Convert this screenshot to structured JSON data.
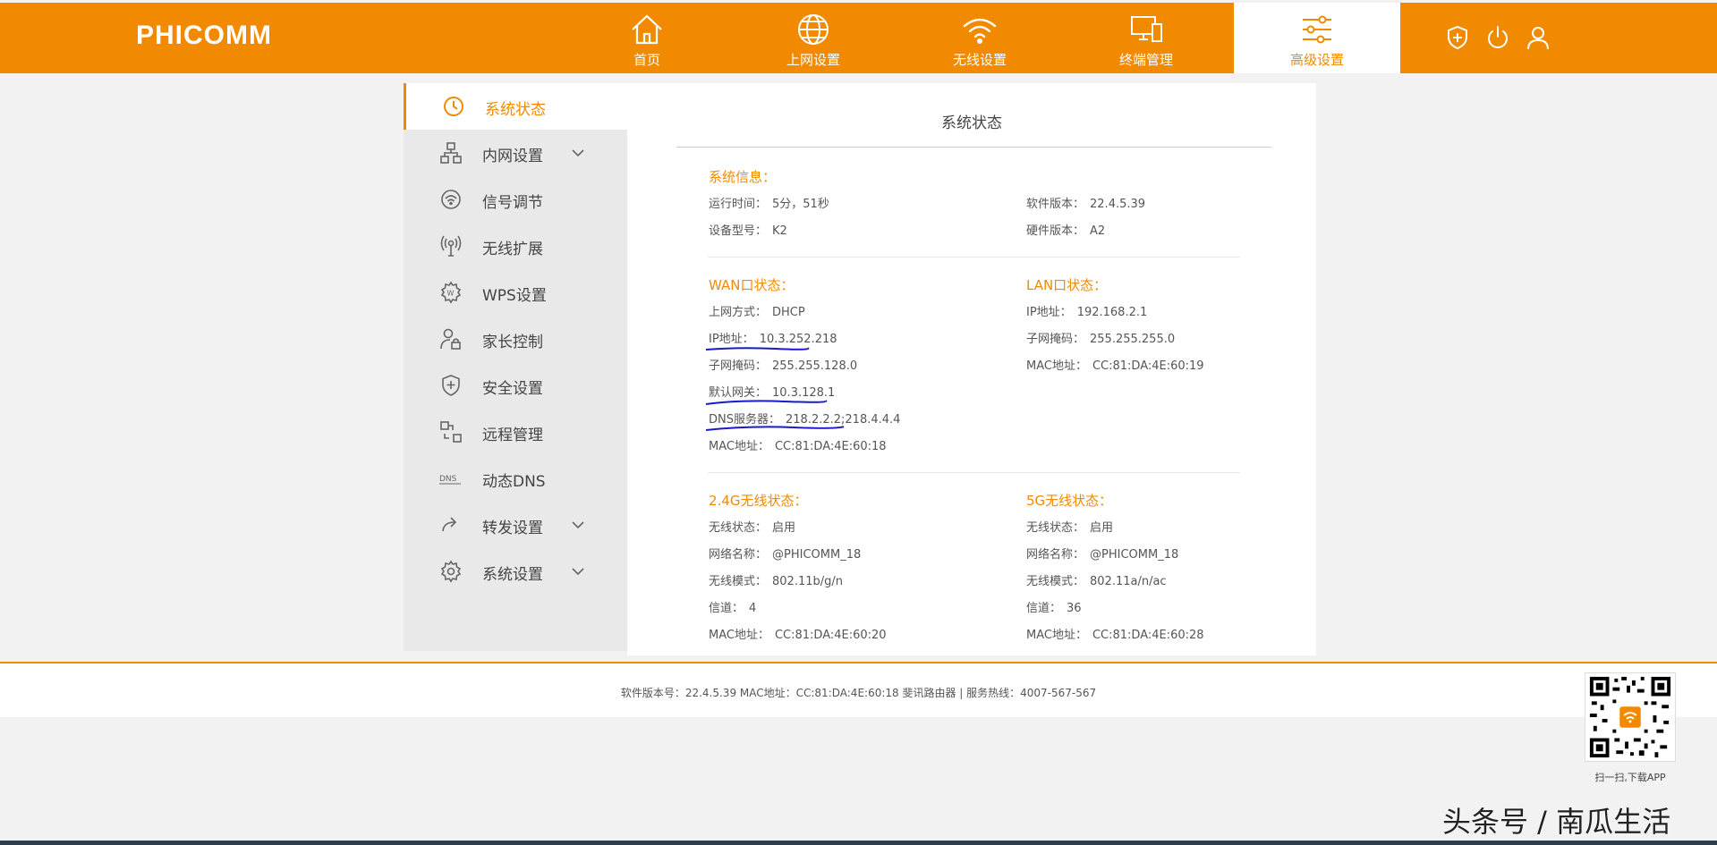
{
  "header": {
    "logo": "PHICOMM",
    "nav": [
      {
        "label": "首页",
        "icon": "home-icon"
      },
      {
        "label": "上网设置",
        "icon": "globe-icon"
      },
      {
        "label": "无线设置",
        "icon": "wifi-icon"
      },
      {
        "label": "终端管理",
        "icon": "devices-icon"
      },
      {
        "label": "高级设置",
        "icon": "sliders-icon"
      }
    ],
    "right_icons": [
      "shield-plus-icon",
      "power-icon",
      "user-icon"
    ]
  },
  "sidebar": {
    "items": [
      {
        "label": "系统状态",
        "icon": "clock-icon"
      },
      {
        "label": "内网设置",
        "icon": "network-icon"
      },
      {
        "label": "信号调节",
        "icon": "signal-icon"
      },
      {
        "label": "无线扩展",
        "icon": "antenna-icon"
      },
      {
        "label": "WPS设置",
        "icon": "wps-gear-icon"
      },
      {
        "label": "家长控制",
        "icon": "parent-lock-icon"
      },
      {
        "label": "安全设置",
        "icon": "shield-plus-icon"
      },
      {
        "label": "远程管理",
        "icon": "remote-icon"
      },
      {
        "label": "动态DNS",
        "icon": "dns-icon"
      },
      {
        "label": "转发设置",
        "icon": "forward-icon"
      },
      {
        "label": "系统设置",
        "icon": "gear-icon"
      }
    ]
  },
  "main": {
    "title": "系统状态",
    "system_info": {
      "title": "系统信息：",
      "uptime_label": "运行时间：",
      "uptime_value": "5分，51秒",
      "model_label": "设备型号：",
      "model_value": "K2",
      "sw_label": "软件版本：",
      "sw_value": "22.4.5.39",
      "hw_label": "硬件版本：",
      "hw_value": "A2"
    },
    "wan": {
      "title": "WAN口状态：",
      "mode_label": "上网方式：",
      "mode_value": "DHCP",
      "ip_label": "IP地址：",
      "ip_value": "10.3.252.218",
      "mask_label": "子网掩码：",
      "mask_value": "255.255.128.0",
      "gw_label": "默认网关：",
      "gw_value": "10.3.128.1",
      "dns_label": "DNS服务器：",
      "dns_value": "218.2.2.2;218.4.4.4",
      "mac_label": "MAC地址：",
      "mac_value": "CC:81:DA:4E:60:18"
    },
    "lan": {
      "title": "LAN口状态：",
      "ip_label": "IP地址：",
      "ip_value": "192.168.2.1",
      "mask_label": "子网掩码：",
      "mask_value": "255.255.255.0",
      "mac_label": "MAC地址：",
      "mac_value": "CC:81:DA:4E:60:19"
    },
    "w24": {
      "title": "2.4G无线状态：",
      "state_label": "无线状态：",
      "state_value": "启用",
      "ssid_label": "网络名称：",
      "ssid_value": "@PHICOMM_18",
      "mode_label": "无线模式：",
      "mode_value": "802.11b/g/n",
      "ch_label": "信道：",
      "ch_value": "4",
      "mac_label": "MAC地址：",
      "mac_value": "CC:81:DA:4E:60:20"
    },
    "w5": {
      "title": "5G无线状态：",
      "state_label": "无线状态：",
      "state_value": "启用",
      "ssid_label": "网络名称：",
      "ssid_value": "@PHICOMM_18",
      "mode_label": "无线模式：",
      "mode_value": "802.11a/n/ac",
      "ch_label": "信道：",
      "ch_value": "36",
      "mac_label": "MAC地址：",
      "mac_value": "CC:81:DA:4E:60:28"
    }
  },
  "footer": {
    "text": "软件版本号：22.4.5.39    MAC地址：CC:81:DA:4E:60:18    斐讯路由器 | 服务热线：4007-567-567",
    "qr_caption": "扫一扫,下载APP"
  },
  "watermark": "头条号 / 南瓜生活",
  "colors": {
    "accent": "#f28a00",
    "annotation": "#1a1acc"
  }
}
